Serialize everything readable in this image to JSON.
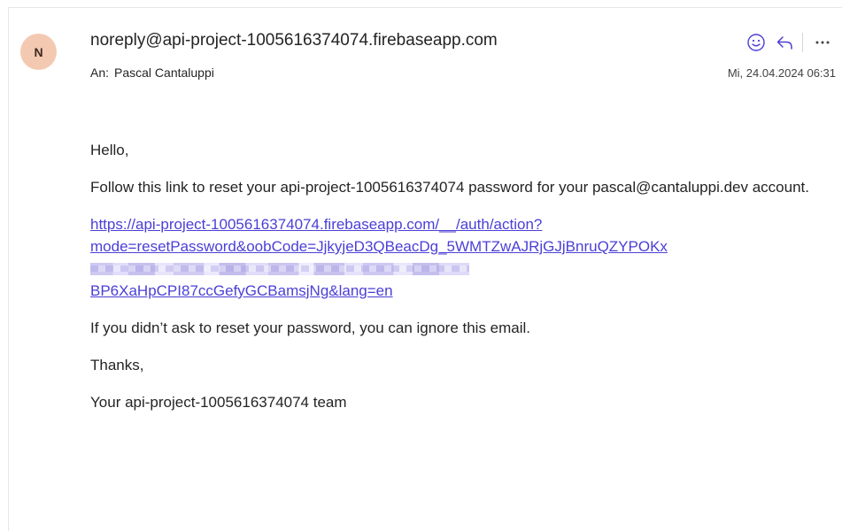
{
  "message": {
    "avatar_initial": "N",
    "sender": "noreply@api-project-1005616374074.firebaseapp.com",
    "to_label": "An:",
    "recipient": "Pascal Cantaluppi",
    "date": "Mi, 24.04.2024 06:31"
  },
  "actions": {
    "emoji": "emoji-react-icon",
    "reply": "reply-icon",
    "more": "more-options-icon"
  },
  "body": {
    "greeting": "Hello,",
    "instruction": "Follow this link to reset your api-project-1005616374074 password for your pascal@cantaluppi.dev account.",
    "link_line1": "https://api-project-1005616374074.firebaseapp.com/__/auth/action?",
    "link_line2": "mode=resetPassword&oobCode=JjkyjeD3QBeacDg_5WMTZwAJRjGJjBnruQZYPOKx",
    "link_line4": "BP6XaHpCPI87ccGefyGCBamsjNg&lang=en",
    "ignore_note": "If you didn’t ask to reset your password, you can ignore this email.",
    "thanks": "Thanks,",
    "signature": "Your api-project-1005616374074 team"
  },
  "colors": {
    "link": "#4a3fd6",
    "avatar_bg": "#f4c9b1",
    "action_icon": "#4a3fd6"
  }
}
